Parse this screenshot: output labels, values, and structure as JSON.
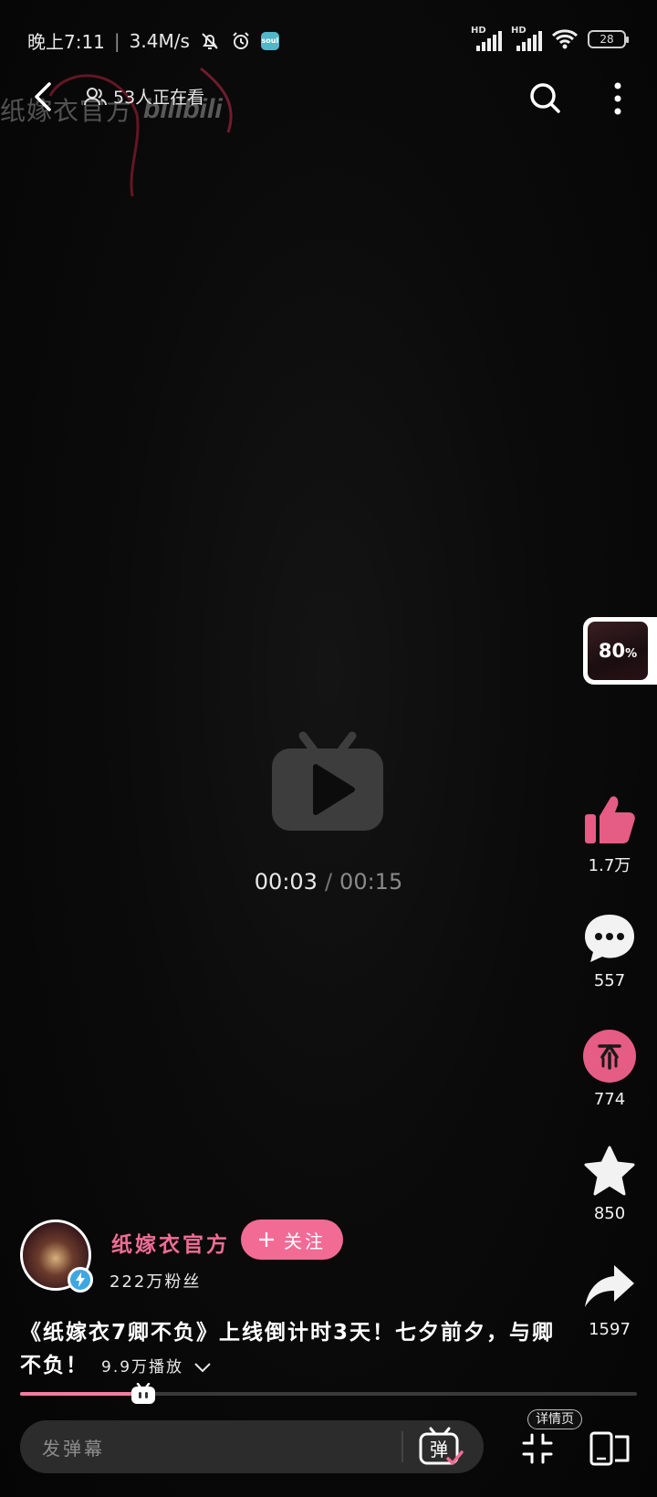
{
  "status_bar": {
    "time": "晚上7:11",
    "net_speed": "3.4M/s",
    "app_badge": "soul",
    "battery": "28"
  },
  "watermark": {
    "channel": "纸嫁衣官方",
    "logo": "bilibili"
  },
  "top_bar": {
    "watching": "53人正在看"
  },
  "player": {
    "current_time": "00:03",
    "separator": "/",
    "total_time": "00:15",
    "progress": 0.2
  },
  "progress_badge": {
    "value": "80",
    "unit": "%"
  },
  "actions": {
    "like_count": "1.7万",
    "comment_count": "557",
    "coin_count": "774",
    "favorite_count": "850",
    "share_count": "1597"
  },
  "author": {
    "name": "纸嫁衣官方",
    "follow_label": "关注",
    "fans": "222万粉丝"
  },
  "video": {
    "title": "《纸嫁衣7卿不负》上线倒计时3天！七夕前夕，与卿不负！",
    "plays": "9.9万播放"
  },
  "bottom_bar": {
    "danmaku_placeholder": "发弹幕",
    "danmaku_toggle": "弹",
    "details_tip": "详情页"
  },
  "colors": {
    "accent": "#f26b95",
    "like": "#e55c84",
    "fill": "#f07ea0"
  }
}
